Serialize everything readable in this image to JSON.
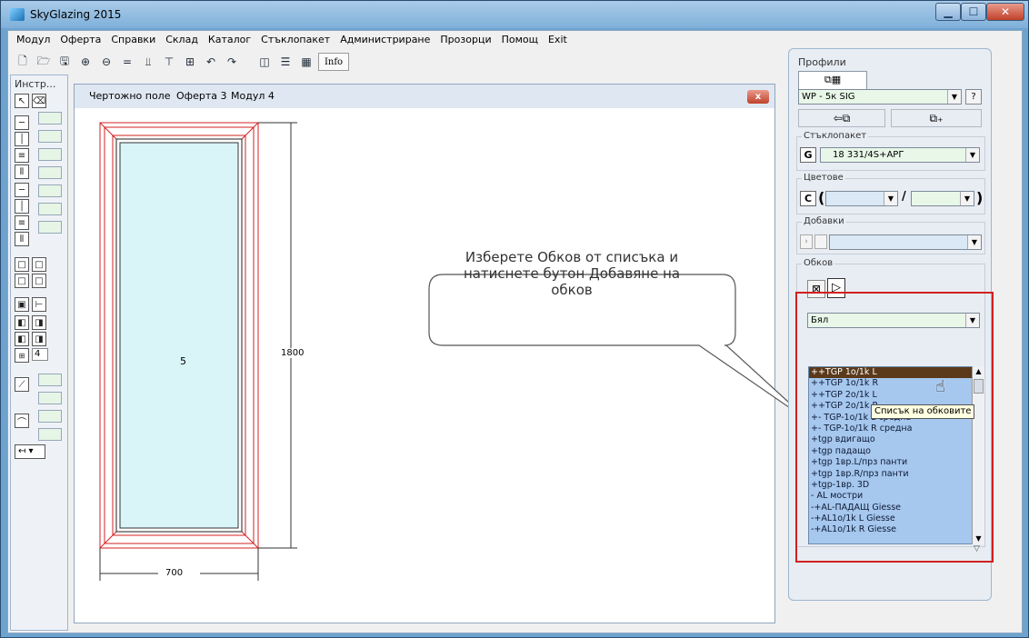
{
  "window": {
    "title": "SkyGlazing 2015"
  },
  "menu": [
    "Модул",
    "Оферта",
    "Справки",
    "Склад",
    "Каталог",
    "Стъклопакет",
    "Администриране",
    "Прозорци",
    "Помощ",
    "Exit"
  ],
  "toolbar": {
    "info_label": "Info"
  },
  "tools": {
    "title": "Инстр...",
    "counter": "4"
  },
  "drawing": {
    "title_field": "Чертожно поле",
    "title_offer": "Оферта 3",
    "title_module": "Модул 4",
    "close_label": "x",
    "sash_number": "5",
    "height_dim": "1800",
    "width_dim": "700"
  },
  "profiles": {
    "title": "Профили",
    "profile_value": "WP - 5к SIG",
    "help_label": "?"
  },
  "glazing": {
    "title": "Стъклопакет",
    "g_label": "G",
    "value": "18 331/4S+АРГ"
  },
  "colors": {
    "title": "Цветове",
    "c_label": "C",
    "open_paren": "(",
    "slash": "/",
    "close_paren": ")"
  },
  "addons": {
    "title": "Добавки"
  },
  "hardware": {
    "title": "Обков",
    "color_value": "Бял",
    "items": [
      "++TGP 1o/1k L",
      "++TGP 1o/1k R",
      "++TGP 2o/1k L",
      "++TGP 2o/1k R",
      "+- TGP-1o/1k L средна",
      "+- TGP-1o/1k R средна",
      "+tgp вдигащо",
      "+tgp падащо",
      "+tgp 1вр.L/прз панти",
      "+tgp 1вр.R/прз панти",
      "+tgp-1вр. 3D",
      "- AL мостри",
      "-+AL-ПАДАЩ Giesse",
      "-+AL1o/1k L Giesse",
      "-+AL1o/1k R Giesse"
    ],
    "selected_index": 0,
    "tooltip": "Списък на обковите"
  },
  "callout": {
    "line1": "Изберете  Обков от списъка и",
    "line2": "натиснете бутон Добавяне на",
    "line3": "обков"
  }
}
